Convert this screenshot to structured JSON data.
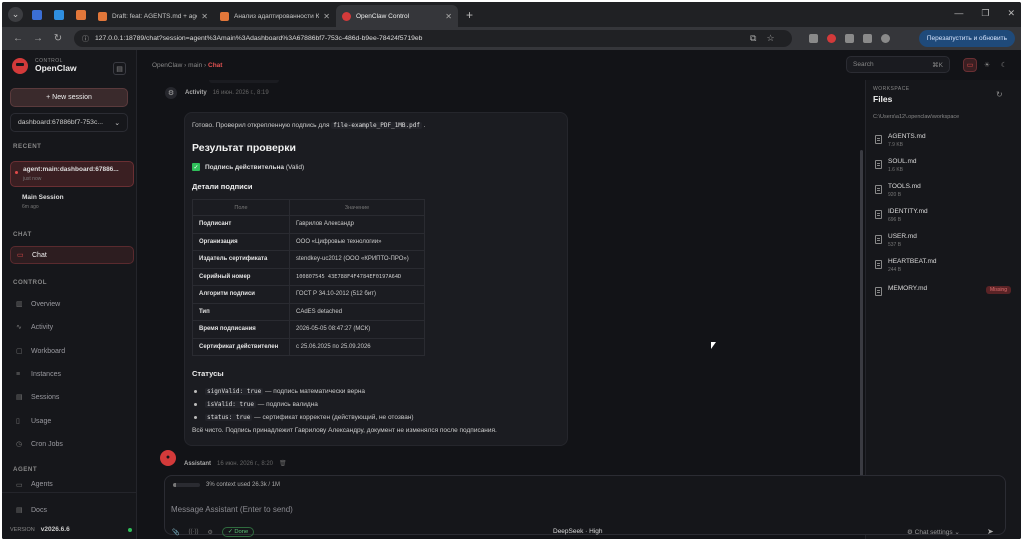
{
  "browser": {
    "tabs": [
      {
        "title": "Draft: feat: AGENTS.md + agent",
        "color": "#e2773a"
      },
      {
        "title": "Анализ адаптированности Кр",
        "color": "#e2773a"
      },
      {
        "title": "OpenClaw Control",
        "color": "#d33a3a",
        "active": true
      }
    ],
    "url": "127.0.0.1:18789/chat?session=agent%3Amain%3Adashboard%3A67886bf7-753c-486d-b9ee-78424f5719eb",
    "relaunch_label": "Перезапустить и обновить"
  },
  "sidebar": {
    "logo_small": "CONTROL",
    "logo_big": "OpenClaw",
    "new_session": "+ New session",
    "session_select": "dashboard:67886bf7-753c...",
    "recent_label": "RECENT",
    "sessions": [
      {
        "title": "agent:main:dashboard:67886...",
        "sub": "just now"
      },
      {
        "title": "Main Session",
        "sub": "6m ago"
      }
    ],
    "chat_label": "CHAT",
    "chat_item": "Chat",
    "control_label": "CONTROL",
    "control_items": [
      "Overview",
      "Activity",
      "Workboard",
      "Instances",
      "Sessions",
      "Usage",
      "Cron Jobs"
    ],
    "agent_label": "AGENT",
    "agent_item": "Agents",
    "docs": "Docs",
    "version_label": "VERSION",
    "version": "v2026.6.6"
  },
  "topbar": {
    "crumb_1": "OpenClaw",
    "crumb_2": "main",
    "crumb_3": "Chat",
    "search_placeholder": "Search",
    "search_shortcut": "⌘K"
  },
  "chat": {
    "activity_name": "Activity",
    "activity_time": "16 июн. 2026 г., 8:19",
    "intro_text": "Готово. Проверил открепленную подпись для",
    "intro_file": "file-example_PDF_1MB.pdf",
    "heading": "Результат проверки",
    "valid_bold": "Подпись действительна",
    "valid_rest": "(Valid)",
    "details_heading": "Детали подписи",
    "table_headers": [
      "Поле",
      "Значение"
    ],
    "table_rows": [
      [
        "Подписант",
        "Гаврилов Александр"
      ],
      [
        "Организация",
        "ООО «Цифровые технологии»"
      ],
      [
        "Издатель сертификата",
        "stendkey-uc2012 (ООО «КРИПТО-ПРО»)"
      ],
      [
        "Серийный номер",
        "100807545 43E788F4F4784EF0197A64D"
      ],
      [
        "Алгоритм подписи",
        "ГОСТ Р 34.10-2012 (512 бит)"
      ],
      [
        "Тип",
        "CAdES detached"
      ],
      [
        "Время подписания",
        "2026-05-05 08:47:27 (МСК)"
      ],
      [
        "Сертификат действителен",
        "с 25.06.2025 по 25.09.2026"
      ]
    ],
    "status_heading": "Статусы",
    "statuses": [
      {
        "code": "signValid: true",
        "text": "— подпись математически верна"
      },
      {
        "code": "isValid: true",
        "text": "— подпись валидна"
      },
      {
        "code": "status: true",
        "text": "— сертификат корректен (действующий, не отозван)"
      }
    ],
    "final_text": "Всё чисто. Подпись принадлежит Гаврилову Александру, документ не изменялся после подписания.",
    "assistant_name": "Assistant",
    "assistant_time": "16 июн. 2026 г., 8:20"
  },
  "composer": {
    "context_fraction": 0.1,
    "context_text": "3% context used 26.3k / 1M",
    "placeholder": "Message Assistant (Enter to send)",
    "done": "✓ Done",
    "model": "DeepSeek · High",
    "settings": "Chat settings"
  },
  "workspace": {
    "label": "WORKSPACE",
    "title": "Files",
    "path": "C:\\Users\\a12\\.openclaw\\workspace",
    "files": [
      {
        "name": "AGENTS.md",
        "size": "7.9 KB"
      },
      {
        "name": "SOUL.md",
        "size": "1.6 KB"
      },
      {
        "name": "TOOLS.md",
        "size": "920 B"
      },
      {
        "name": "IDENTITY.md",
        "size": "696 B"
      },
      {
        "name": "USER.md",
        "size": "537 B"
      },
      {
        "name": "HEARTBEAT.md",
        "size": "244 B"
      },
      {
        "name": "MEMORY.md",
        "size": ""
      }
    ],
    "missing_label": "Missing"
  }
}
